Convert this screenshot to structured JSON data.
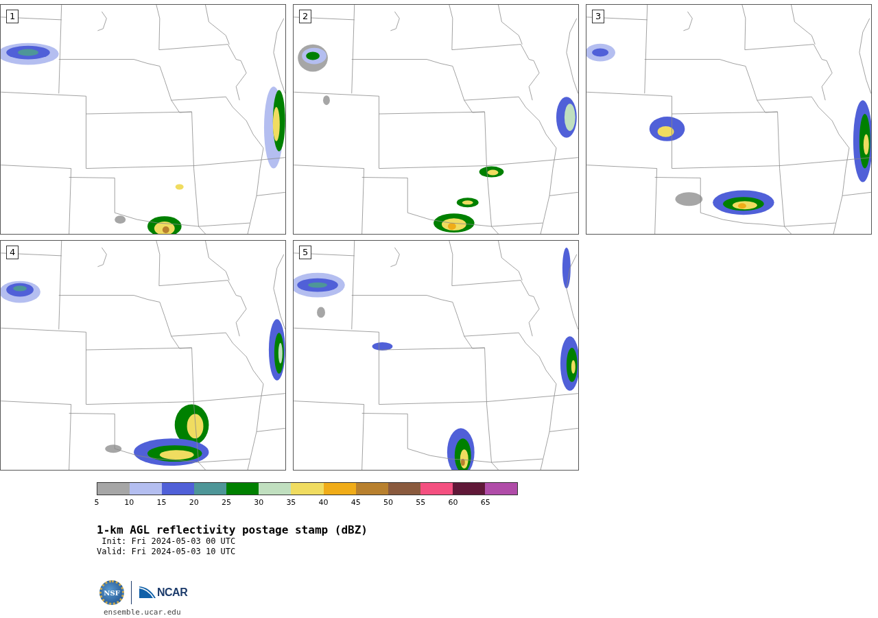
{
  "panels": [
    {
      "label": "1"
    },
    {
      "label": "2"
    },
    {
      "label": "3"
    },
    {
      "label": "4"
    },
    {
      "label": "5"
    }
  ],
  "colorbar": {
    "segments": [
      {
        "color": "#a6a6a6"
      },
      {
        "color": "#b4bef0"
      },
      {
        "color": "#5060d8"
      },
      {
        "color": "#4e9698"
      },
      {
        "color": "#008000"
      },
      {
        "color": "#c0dfbf"
      },
      {
        "color": "#f0dc60"
      },
      {
        "color": "#f0ac18"
      },
      {
        "color": "#b8802e"
      },
      {
        "color": "#8a5a3e"
      },
      {
        "color": "#f45080"
      },
      {
        "color": "#601838"
      },
      {
        "color": "#b04ca8"
      }
    ],
    "ticks": [
      "5",
      "10",
      "15",
      "20",
      "25",
      "30",
      "35",
      "40",
      "45",
      "50",
      "55",
      "60",
      "65"
    ]
  },
  "title": "1-km AGL reflectivity postage stamp (dBZ)",
  "init": " Init: Fri 2024-05-03 00 UTC",
  "valid": "Valid: Fri 2024-05-03 10 UTC",
  "logo": {
    "seal_text": "NSF",
    "wordmark": "NCAR"
  },
  "url": "ensemble.ucar.edu"
}
